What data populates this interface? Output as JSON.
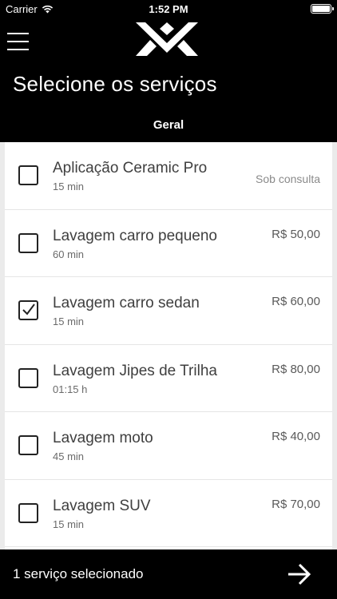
{
  "status_bar": {
    "carrier": "Carrier",
    "time": "1:52 PM"
  },
  "header": {
    "title": "Selecione os serviços",
    "tab": "Geral"
  },
  "services": [
    {
      "name": "Aplicação Ceramic Pro",
      "duration": "15 min",
      "price": "Sob consulta",
      "checked": false
    },
    {
      "name": "Lavagem carro pequeno",
      "duration": "60 min",
      "price": "R$ 50,00",
      "checked": false
    },
    {
      "name": "Lavagem carro sedan",
      "duration": "15 min",
      "price": "R$ 60,00",
      "checked": true
    },
    {
      "name": "Lavagem Jipes de Trilha",
      "duration": "01:15 h",
      "price": "R$ 80,00",
      "checked": false
    },
    {
      "name": "Lavagem moto",
      "duration": "45 min",
      "price": "R$ 40,00",
      "checked": false
    },
    {
      "name": "Lavagem SUV",
      "duration": "15 min",
      "price": "R$ 70,00",
      "checked": false
    }
  ],
  "footer": {
    "summary": "1 serviço selecionado"
  },
  "icons": [
    "wifi-icon",
    "battery-icon",
    "menu-icon",
    "logo-icon",
    "checkmark-icon",
    "arrow-right-icon"
  ],
  "colors": {
    "background": "#000000",
    "list_background": "#ffffff",
    "text": "#3f3f3f"
  }
}
